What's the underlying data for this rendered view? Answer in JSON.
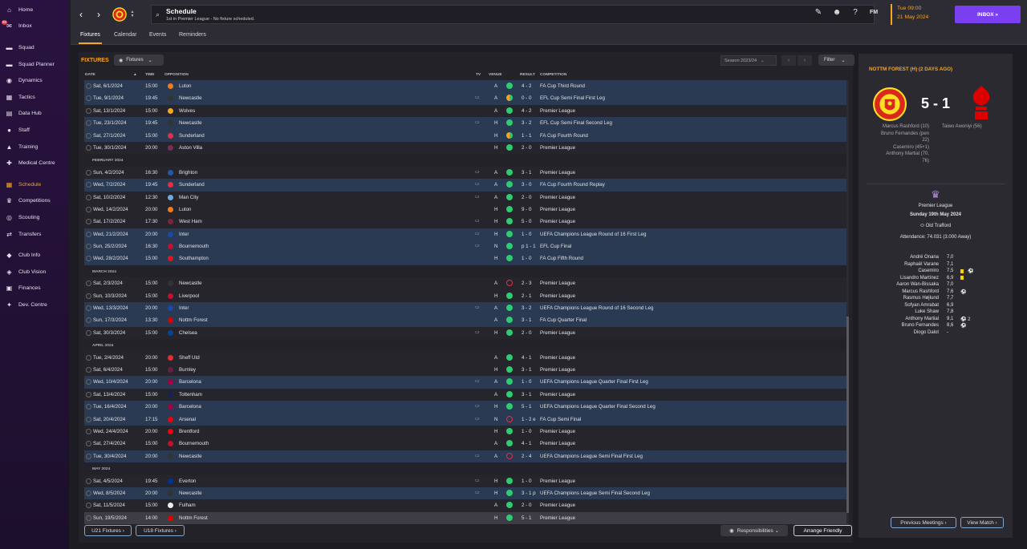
{
  "sidebar": {
    "items": [
      {
        "label": "Home",
        "icon": "home-icon",
        "glyph": "⌂"
      },
      {
        "label": "Inbox",
        "icon": "inbox-icon",
        "glyph": "✉"
      },
      {
        "label": "Squad",
        "icon": "squad-icon",
        "glyph": "▬"
      },
      {
        "label": "Squad Planner",
        "icon": "planner-icon",
        "glyph": "▬"
      },
      {
        "label": "Dynamics",
        "icon": "dynamics-icon",
        "glyph": "◉"
      },
      {
        "label": "Tactics",
        "icon": "tactics-icon",
        "glyph": "▦"
      },
      {
        "label": "Data Hub",
        "icon": "data-hub-icon",
        "glyph": "▤"
      },
      {
        "label": "Staff",
        "icon": "staff-icon",
        "glyph": "●"
      },
      {
        "label": "Training",
        "icon": "training-icon",
        "glyph": "▲"
      },
      {
        "label": "Medical Centre",
        "icon": "medical-icon",
        "glyph": "✚"
      },
      {
        "label": "Schedule",
        "icon": "schedule-icon",
        "glyph": "▦"
      },
      {
        "label": "Competitions",
        "icon": "trophy-icon",
        "glyph": "♛"
      },
      {
        "label": "Scouting",
        "icon": "scouting-icon",
        "glyph": "◎"
      },
      {
        "label": "Transfers",
        "icon": "transfers-icon",
        "glyph": "⇄"
      },
      {
        "label": "Club Info",
        "icon": "club-info-icon",
        "glyph": "◆"
      },
      {
        "label": "Club Vision",
        "icon": "club-vision-icon",
        "glyph": "◈"
      },
      {
        "label": "Finances",
        "icon": "finances-icon",
        "glyph": "▣"
      },
      {
        "label": "Dev. Centre",
        "icon": "dev-centre-icon",
        "glyph": "✦"
      }
    ],
    "inbox_badge": "50"
  },
  "topbar": {
    "title": "Schedule",
    "subtitle": "1st in Premier League - No fixture scheduled.",
    "date_line1": "Tue 09:00",
    "date_line2": "21 May 2024",
    "inbox_label": "INBOX  »",
    "fm_label": "FM"
  },
  "subtabs": [
    "Fixtures",
    "Calendar",
    "Events",
    "Reminders"
  ],
  "fixtures": {
    "title": "FIXTURES",
    "filter_label": "Fixtures",
    "season": "Season 2023/24",
    "filter_btn": "Filter",
    "columns": {
      "date": "DATE",
      "time": "TIME",
      "opposition": "OPPOSITION",
      "tv": "TV",
      "venue": "VENUE",
      "result": "RESULT",
      "competition": "COMPETITION"
    },
    "rows": [
      {
        "t": "f",
        "date": "Sat, 6/1/2024",
        "time": "15:00",
        "opp": "Luton",
        "tv": "",
        "venue": "A",
        "res": "w",
        "score": "4 - 2",
        "comp": "FA Cup Third Round",
        "style": "alt",
        "c": "#f27b1a"
      },
      {
        "t": "f",
        "date": "Tue, 9/1/2024",
        "time": "19:45",
        "opp": "Newcastle",
        "tv": "▭",
        "venue": "A",
        "res": "d",
        "score": "0 - 0",
        "comp": "EFL Cup Semi Final First Leg",
        "style": "alt",
        "c": "#333"
      },
      {
        "t": "f",
        "date": "Sat, 13/1/2024",
        "time": "15:00",
        "opp": "Wolves",
        "tv": "",
        "venue": "A",
        "res": "w",
        "score": "4 - 2",
        "comp": "Premier League",
        "style": "base",
        "c": "#f5a623"
      },
      {
        "t": "f",
        "date": "Tue, 23/1/2024",
        "time": "19:45",
        "opp": "Newcastle",
        "tv": "▭",
        "venue": "H",
        "res": "w",
        "score": "3 - 2",
        "comp": "EFL Cup Semi Final Second Leg",
        "style": "alt",
        "c": "#333"
      },
      {
        "t": "f",
        "date": "Sat, 27/1/2024",
        "time": "15:00",
        "opp": "Sunderland",
        "tv": "",
        "venue": "H",
        "res": "d",
        "score": "1 - 1",
        "comp": "FA Cup Fourth Round",
        "style": "alt",
        "c": "#e0304a"
      },
      {
        "t": "f",
        "date": "Tue, 30/1/2024",
        "time": "20:00",
        "opp": "Aston Villa",
        "tv": "",
        "venue": "H",
        "res": "w",
        "score": "2 - 0",
        "comp": "Premier League",
        "style": "base",
        "c": "#7b2d5a"
      },
      {
        "t": "m",
        "label": "FEBRUARY 2024"
      },
      {
        "t": "f",
        "date": "Sun, 4/2/2024",
        "time": "16:30",
        "opp": "Brighton",
        "tv": "▭",
        "venue": "A",
        "res": "w",
        "score": "3 - 1",
        "comp": "Premier League",
        "style": "base",
        "c": "#1e5aa8"
      },
      {
        "t": "f",
        "date": "Wed, 7/2/2024",
        "time": "19:45",
        "opp": "Sunderland",
        "tv": "▭",
        "venue": "A",
        "res": "w",
        "score": "3 - 0",
        "comp": "FA Cup Fourth Round Replay",
        "style": "alt",
        "c": "#e0304a"
      },
      {
        "t": "f",
        "date": "Sat, 10/2/2024",
        "time": "12:30",
        "opp": "Man City",
        "tv": "▭",
        "venue": "A",
        "res": "w",
        "score": "2 - 0",
        "comp": "Premier League",
        "style": "base",
        "c": "#6cabdd"
      },
      {
        "t": "f",
        "date": "Wed, 14/2/2024",
        "time": "20:00",
        "opp": "Luton",
        "tv": "",
        "venue": "H",
        "res": "w",
        "score": "9 - 0",
        "comp": "Premier League",
        "style": "base",
        "c": "#f27b1a"
      },
      {
        "t": "f",
        "date": "Sat, 17/2/2024",
        "time": "17:30",
        "opp": "West Ham",
        "tv": "▭",
        "venue": "H",
        "res": "w",
        "score": "5 - 0",
        "comp": "Premier League",
        "style": "base",
        "c": "#7a263a"
      },
      {
        "t": "f",
        "date": "Wed, 21/2/2024",
        "time": "20:00",
        "opp": "Inter",
        "tv": "▭",
        "venue": "H",
        "res": "w",
        "score": "1 - 0",
        "comp": "UEFA Champions League Round of 16  First Leg",
        "style": "alt",
        "c": "#1a4aa8"
      },
      {
        "t": "f",
        "date": "Sun, 25/2/2024",
        "time": "16:30",
        "opp": "Bournemouth",
        "tv": "▭",
        "venue": "N",
        "res": "w",
        "score": "p 1 - 1",
        "comp": "EFL Cup Final",
        "style": "alt",
        "c": "#c8102e"
      },
      {
        "t": "f",
        "date": "Wed, 28/2/2024",
        "time": "15:00",
        "opp": "Southampton",
        "tv": "",
        "venue": "H",
        "res": "w",
        "score": "1 - 0",
        "comp": "FA Cup Fifth Round",
        "style": "alt",
        "c": "#d71920"
      },
      {
        "t": "m",
        "label": "MARCH 2024"
      },
      {
        "t": "f",
        "date": "Sat, 2/3/2024",
        "time": "15:00",
        "opp": "Newcastle",
        "tv": "",
        "venue": "A",
        "res": "l",
        "score": "2 - 3",
        "comp": "Premier League",
        "style": "base",
        "c": "#333"
      },
      {
        "t": "f",
        "date": "Sun, 10/3/2024",
        "time": "15:00",
        "opp": "Liverpool",
        "tv": "",
        "venue": "H",
        "res": "w",
        "score": "2 - 1",
        "comp": "Premier League",
        "style": "base",
        "c": "#c8102e"
      },
      {
        "t": "f",
        "date": "Wed, 13/3/2024",
        "time": "20:00",
        "opp": "Inter",
        "tv": "▭",
        "venue": "A",
        "res": "w",
        "score": "3 - 2",
        "comp": "UEFA Champions League Round of 16  Second Leg",
        "style": "alt",
        "c": "#1a4aa8"
      },
      {
        "t": "f",
        "date": "Sun, 17/3/2024",
        "time": "13:30",
        "opp": "Nottm Forest",
        "tv": "",
        "venue": "A",
        "res": "w",
        "score": "3 - 1",
        "comp": "FA Cup Quarter Final",
        "style": "alt",
        "c": "#dd0000"
      },
      {
        "t": "f",
        "date": "Sat, 30/3/2024",
        "time": "15:00",
        "opp": "Chelsea",
        "tv": "▭",
        "venue": "H",
        "res": "w",
        "score": "2 - 0",
        "comp": "Premier League",
        "style": "base",
        "c": "#034694"
      },
      {
        "t": "m",
        "label": "APRIL 2024"
      },
      {
        "t": "f",
        "date": "Tue, 2/4/2024",
        "time": "20:00",
        "opp": "Sheff Utd",
        "tv": "",
        "venue": "A",
        "res": "w",
        "score": "4 - 1",
        "comp": "Premier League",
        "style": "base",
        "c": "#ee2737"
      },
      {
        "t": "f",
        "date": "Sat, 6/4/2024",
        "time": "15:00",
        "opp": "Burnley",
        "tv": "",
        "venue": "H",
        "res": "w",
        "score": "3 - 1",
        "comp": "Premier League",
        "style": "base",
        "c": "#6c1d45"
      },
      {
        "t": "f",
        "date": "Wed, 10/4/2024",
        "time": "20:00",
        "opp": "Barcelona",
        "tv": "▭",
        "venue": "A",
        "res": "w",
        "score": "1 - 0",
        "comp": "UEFA Champions League Quarter Final First Leg",
        "style": "alt",
        "c": "#a50044"
      },
      {
        "t": "f",
        "date": "Sat, 13/4/2024",
        "time": "15:00",
        "opp": "Tottenham",
        "tv": "",
        "venue": "A",
        "res": "w",
        "score": "3 - 1",
        "comp": "Premier League",
        "style": "base",
        "c": "#132257"
      },
      {
        "t": "f",
        "date": "Tue, 16/4/2024",
        "time": "20:00",
        "opp": "Barcelona",
        "tv": "▭",
        "venue": "H",
        "res": "w",
        "score": "5 - 1",
        "comp": "UEFA Champions League Quarter Final Second Leg",
        "style": "alt",
        "c": "#a50044"
      },
      {
        "t": "f",
        "date": "Sat, 20/4/2024",
        "time": "17:15",
        "opp": "Arsenal",
        "tv": "▭",
        "venue": "N",
        "res": "l",
        "score": "1 - 2 e",
        "comp": "FA Cup Semi Final",
        "style": "alt",
        "c": "#ef0107"
      },
      {
        "t": "f",
        "date": "Wed, 24/4/2024",
        "time": "20:00",
        "opp": "Brentford",
        "tv": "",
        "venue": "H",
        "res": "w",
        "score": "1 - 0",
        "comp": "Premier League",
        "style": "base",
        "c": "#e30613"
      },
      {
        "t": "f",
        "date": "Sat, 27/4/2024",
        "time": "15:00",
        "opp": "Bournemouth",
        "tv": "",
        "venue": "A",
        "res": "w",
        "score": "4 - 1",
        "comp": "Premier League",
        "style": "base",
        "c": "#c8102e"
      },
      {
        "t": "f",
        "date": "Tue, 30/4/2024",
        "time": "20:00",
        "opp": "Newcastle",
        "tv": "▭",
        "venue": "A",
        "res": "l",
        "score": "2 - 4",
        "comp": "UEFA Champions League Semi Final First Leg",
        "style": "alt",
        "c": "#333"
      },
      {
        "t": "m",
        "label": "MAY 2024"
      },
      {
        "t": "f",
        "date": "Sat, 4/5/2024",
        "time": "19:45",
        "opp": "Everton",
        "tv": "▭",
        "venue": "H",
        "res": "w",
        "score": "1 - 0",
        "comp": "Premier League",
        "style": "base",
        "c": "#003399"
      },
      {
        "t": "f",
        "date": "Wed, 8/5/2024",
        "time": "20:00",
        "opp": "Newcastle",
        "tv": "▭",
        "venue": "H",
        "res": "w",
        "score": "3 - 1 p",
        "comp": "UEFA Champions League Semi Final Second Leg",
        "style": "alt",
        "c": "#333"
      },
      {
        "t": "f",
        "date": "Sat, 11/5/2024",
        "time": "15:00",
        "opp": "Fulham",
        "tv": "",
        "venue": "A",
        "res": "w",
        "score": "2 - 0",
        "comp": "Premier League",
        "style": "base",
        "c": "#eee"
      },
      {
        "t": "f",
        "date": "Sun, 19/5/2024",
        "time": "14:00",
        "opp": "Nottm Forest",
        "tv": "",
        "venue": "H",
        "res": "w",
        "score": "5 - 1",
        "comp": "Premier League",
        "style": "sel",
        "c": "#dd0000"
      }
    ],
    "u21_btn": "U21 Fixtures  ›",
    "u18_btn": "U18 Fixtures  ›",
    "responsibilities_btn": "Responsibilities  ⌄",
    "arrange_btn": "Arrange Friendly"
  },
  "match": {
    "title": "NOTTM FOREST (H) (2 DAYS AGO)",
    "score": "5 - 1",
    "home_scorers": [
      "Marcus Rashford (10)",
      "Bruno Fernandes (pen",
      "22)",
      "Casemiro (45+1)",
      "Anthony Martial (70,",
      "76)"
    ],
    "away_scorers": [
      "Taiwo Awoniyi (56)"
    ],
    "competition": "Premier League",
    "date": "Sunday 19th May 2024",
    "stadium": "Old Trafford",
    "attendance": "Attendance: 74.031 (3.000 Away)",
    "lineup": [
      {
        "name": "André Onana",
        "rating": "7,0",
        "ev": ""
      },
      {
        "name": "Raphaël Varane",
        "rating": "7,1",
        "ev": ""
      },
      {
        "name": "Casemiro",
        "rating": "7,5",
        "ev": "yc-goal"
      },
      {
        "name": "Lisandro Martínez",
        "rating": "6,9",
        "ev": "yc"
      },
      {
        "name": "Aaron Wan-Bissaka",
        "rating": "7,0",
        "ev": ""
      },
      {
        "name": "Marcus Rashford",
        "rating": "7,6",
        "ev": "goal"
      },
      {
        "name": "Rasmus Højlund",
        "rating": "7,7",
        "ev": ""
      },
      {
        "name": "Sofyan Amrabat",
        "rating": "6,9",
        "ev": ""
      },
      {
        "name": "Luke Shaw",
        "rating": "7,8",
        "ev": ""
      },
      {
        "name": "Anthony Martial",
        "rating": "9,1",
        "ev": "goal2"
      },
      {
        "name": "Bruno Fernandes",
        "rating": "8,6",
        "ev": "goal"
      },
      {
        "name": "Diogo Dalot",
        "rating": "-",
        "ev": ""
      }
    ],
    "goal_count": "2",
    "prev_meetings": "Previous Meetings  ›",
    "view_match": "View Match  ›"
  },
  "colors": {
    "accent": "#f5a623",
    "purple": "#7b3ff2",
    "win": "#2ecc71",
    "loss": "#e0304a"
  }
}
